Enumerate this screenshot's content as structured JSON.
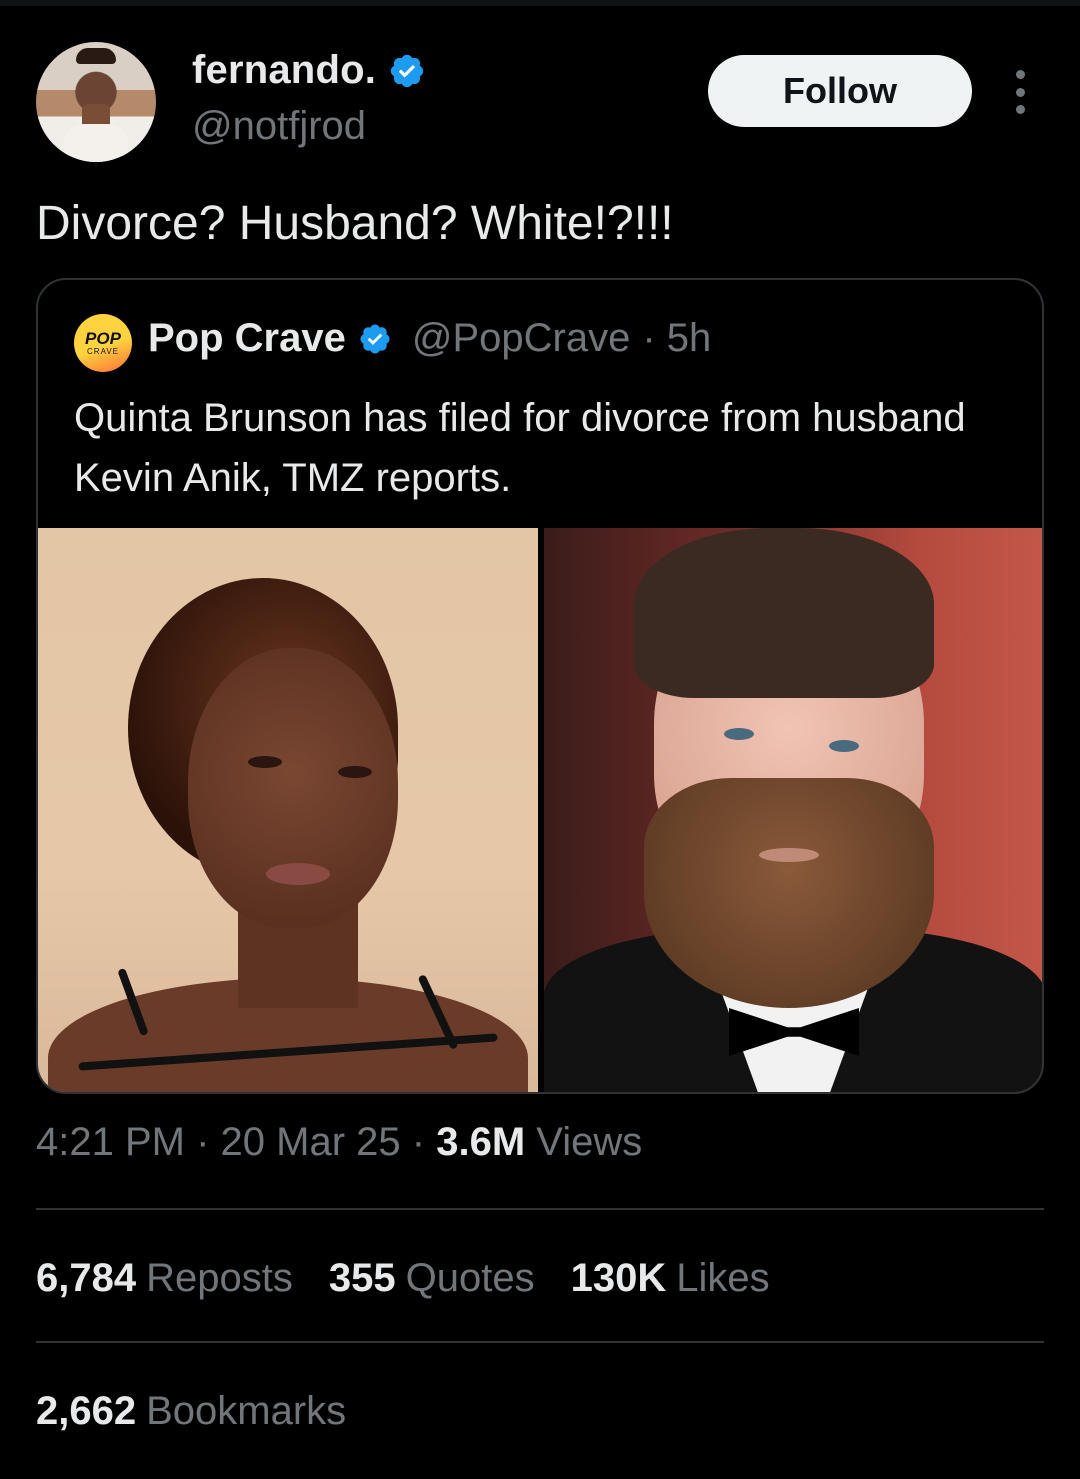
{
  "author": {
    "display_name": "fernando.",
    "handle": "@notfjrod",
    "verified": true
  },
  "follow_label": "Follow",
  "tweet_text": "Divorce? Husband? White!?!!!",
  "quoted": {
    "avatar_top": "POP",
    "avatar_bottom": "CRAVE",
    "name": "Pop Crave",
    "handle": "@PopCrave",
    "time": "· 5h",
    "text": "Quinta Brunson has filed for divorce from husband Kevin Anik, TMZ reports."
  },
  "meta": {
    "time": "4:21 PM",
    "sep1": "·",
    "date": "20 Mar 25",
    "sep2": "·",
    "views_count": "3.6M",
    "views_label": "Views"
  },
  "stats": {
    "reposts_count": "6,784",
    "reposts_label": "Reposts",
    "quotes_count": "355",
    "quotes_label": "Quotes",
    "likes_count": "130K",
    "likes_label": "Likes",
    "bookmarks_count": "2,662",
    "bookmarks_label": "Bookmarks"
  },
  "colors": {
    "background": "#000000",
    "verified": "#1d9bf0",
    "secondary_text": "#71767b",
    "primary_text": "#e7e9ea"
  },
  "icons": [
    "verified-badge-icon",
    "more-options-icon"
  ]
}
